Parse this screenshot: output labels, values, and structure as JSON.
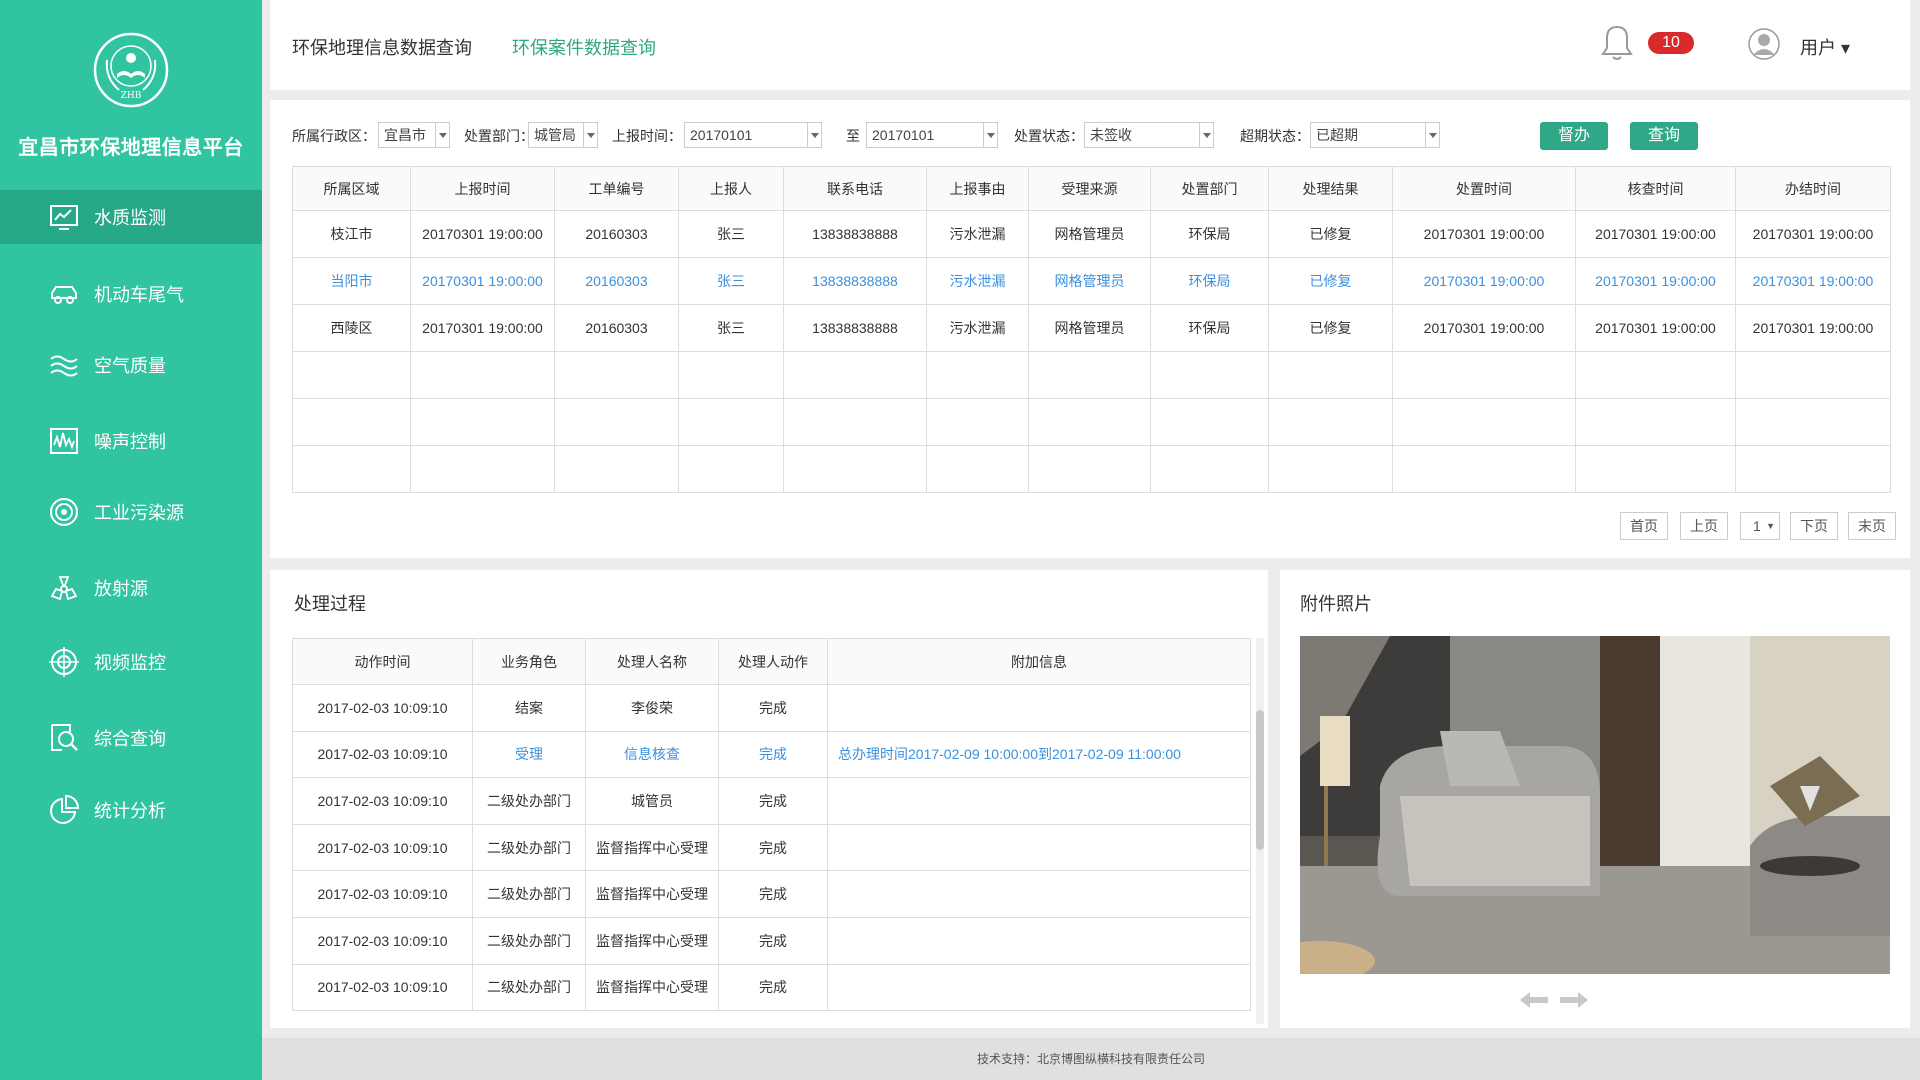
{
  "sidebar": {
    "platform_title": "宜昌市环保地理信息平台",
    "logo_text": "ZHB",
    "items": [
      {
        "label": "水质监测",
        "icon": "chart-monitor-icon"
      },
      {
        "label": "机动车尾气",
        "icon": "car-icon"
      },
      {
        "label": "空气质量",
        "icon": "air-waves-icon"
      },
      {
        "label": "噪声控制",
        "icon": "noise-wave-icon"
      },
      {
        "label": "工业污染源",
        "icon": "target-icon"
      },
      {
        "label": "放射源",
        "icon": "radiation-icon"
      },
      {
        "label": "视频监控",
        "icon": "crosshair-icon"
      },
      {
        "label": "综合查询",
        "icon": "search-doc-icon"
      },
      {
        "label": "统计分析",
        "icon": "pie-chart-icon"
      }
    ]
  },
  "header": {
    "tabs": [
      "环保地理信息数据查询",
      "环保案件数据查询"
    ],
    "notification_count": "10",
    "user_label": "用户 ▾"
  },
  "filters": {
    "region_label": "所属行政区：",
    "region_value": "宜昌市",
    "dept_label": "处置部门：",
    "dept_value": "城管局",
    "time_label": "上报时间：",
    "time_from": "20170101",
    "to_label": "至",
    "time_to": "20170101",
    "status_label": "处置状态：",
    "status_value": "未签收",
    "overdue_label": "超期状态：",
    "overdue_value": "已超期",
    "supervise_button": "督办",
    "query_button": "查询"
  },
  "case_table": {
    "columns": [
      "所属区域",
      "上报时间",
      "工单编号",
      "上报人",
      "联系电话",
      "上报事由",
      "受理来源",
      "处置部门",
      "处理结果",
      "处置时间",
      "核查时间",
      "办结时间"
    ],
    "rows": [
      [
        "枝江市",
        "20170301  19:00:00",
        "20160303",
        "张三",
        "13838838888",
        "污水泄漏",
        "网格管理员",
        "环保局",
        "已修复",
        "20170301  19:00:00",
        "20170301  19:00:00",
        "20170301  19:00:00"
      ],
      [
        "当阳市",
        "20170301  19:00:00",
        "20160303",
        "张三",
        "13838838888",
        "污水泄漏",
        "网格管理员",
        "环保局",
        "已修复",
        "20170301  19:00:00",
        "20170301  19:00:00",
        "20170301  19:00:00"
      ],
      [
        "西陵区",
        "20170301  19:00:00",
        "20160303",
        "张三",
        "13838838888",
        "污水泄漏",
        "网格管理员",
        "环保局",
        "已修复",
        "20170301  19:00:00",
        "20170301  19:00:00",
        "20170301  19:00:00"
      ]
    ]
  },
  "pager": {
    "first": "首页",
    "prev": "上页",
    "page": "1",
    "next": "下页",
    "last": "末页"
  },
  "process": {
    "title": "处理过程",
    "columns": [
      "动作时间",
      "业务角色",
      "处理人名称",
      "处理人动作",
      "附加信息"
    ],
    "rows": [
      [
        "2017-02-03    10:09:10",
        "结案",
        "李俊荣",
        "完成",
        ""
      ],
      [
        "2017-02-03    10:09:10",
        "受理",
        "信息核查",
        "完成",
        "总办理时间2017-02-09  10:00:00到2017-02-09  11:00:00"
      ],
      [
        "2017-02-03    10:09:10",
        "二级处办部门",
        "城管员",
        "完成",
        ""
      ],
      [
        "2017-02-03    10:09:10",
        "二级处办部门",
        "监督指挥中心受理",
        "完成",
        ""
      ],
      [
        "2017-02-03    10:09:10",
        "二级处办部门",
        "监督指挥中心受理",
        "完成",
        ""
      ],
      [
        "2017-02-03    10:09:10",
        "二级处办部门",
        "监督指挥中心受理",
        "完成",
        ""
      ],
      [
        "2017-02-03    10:09:10",
        "二级处办部门",
        "监督指挥中心受理",
        "完成",
        ""
      ]
    ]
  },
  "photos": {
    "title": "附件照片"
  },
  "footer": {
    "text": "技术支持：北京博图纵横科技有限责任公司"
  },
  "colors": {
    "sidebar": "#31c4a0",
    "sidebar_active": "#27a887",
    "button": "#2fa888",
    "highlight_text": "#3b8fde",
    "badge": "#d9292b"
  }
}
